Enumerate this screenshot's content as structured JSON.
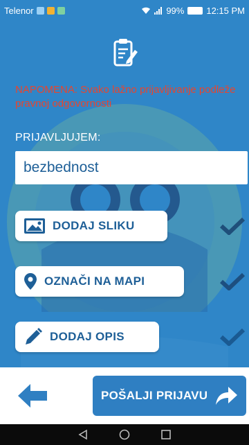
{
  "status_bar": {
    "carrier": "Telenor",
    "battery": "99%",
    "time": "12:15 PM"
  },
  "notice": "NAPOMENA: Svako lažno prijavljivanje podleže pravnoj odgovornosti",
  "report_label": "PRIJAVLJUJEM:",
  "category_value": "bezbednost",
  "actions": [
    {
      "label": "DODAJ SLIKU",
      "icon": "image-icon",
      "done": true
    },
    {
      "label": "OZNAČI NA MAPI",
      "icon": "map-pin-icon",
      "done": true
    },
    {
      "label": "DODAJ OPIS",
      "icon": "pencil-icon",
      "done": true
    }
  ],
  "send_label": "POŠALJI PRIJAVU",
  "colors": {
    "primary": "#2f86c8",
    "accent_text": "#1e5f97",
    "notice": "#e8452e",
    "check": "#1f5a8c"
  }
}
